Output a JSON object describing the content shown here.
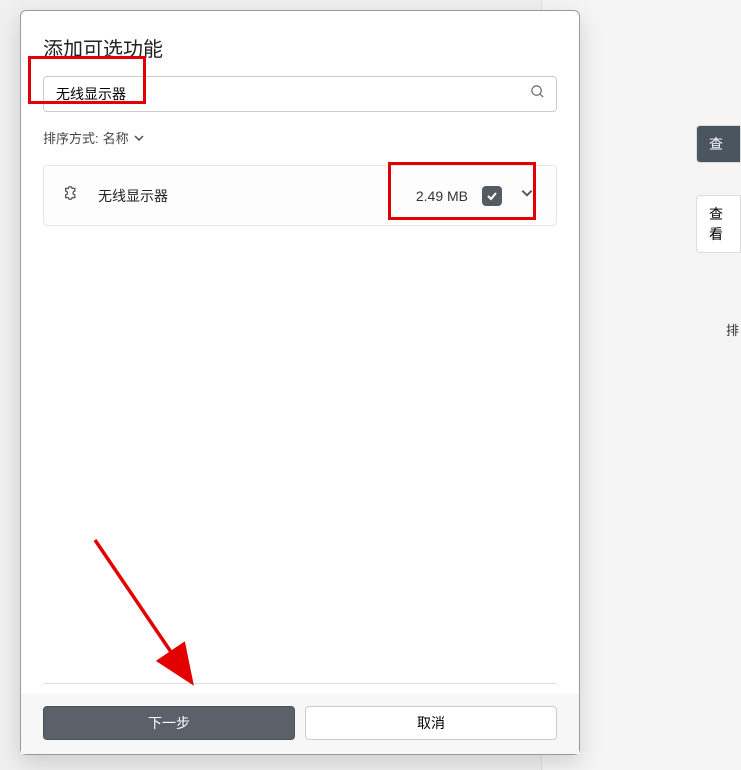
{
  "dialog": {
    "title": "添加可选功能",
    "search": {
      "value": "无线显示器"
    },
    "sort": {
      "label": "排序方式:",
      "value": "名称"
    },
    "feature": {
      "name": "无线显示器",
      "size": "2.49 MB",
      "checked": true
    },
    "buttons": {
      "next": "下一步",
      "cancel": "取消"
    }
  },
  "background": {
    "btn1": "查",
    "btn2": "查看",
    "txt1": "排"
  }
}
